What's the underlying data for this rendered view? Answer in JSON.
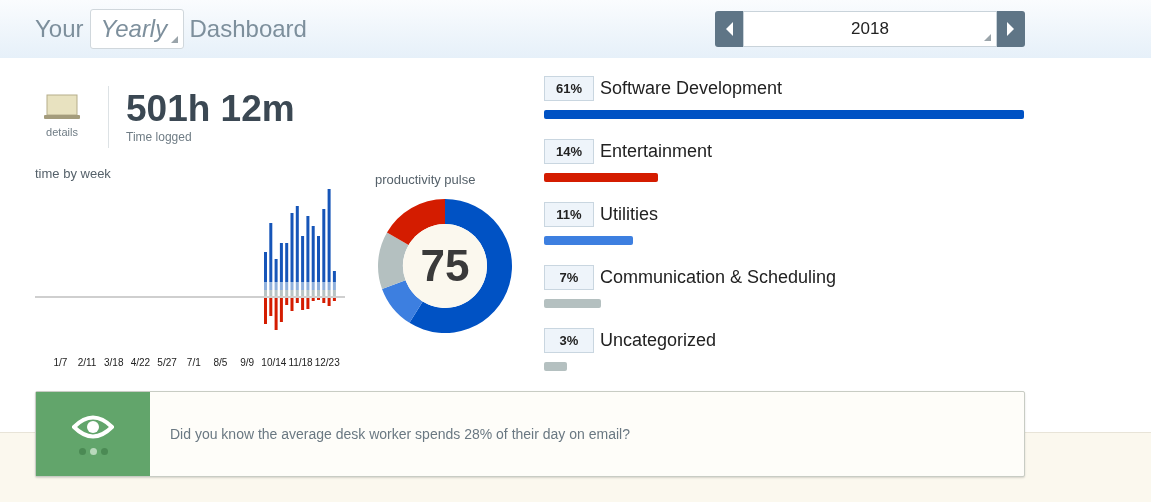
{
  "header": {
    "prefix": "Your",
    "period": "Yearly",
    "suffix": "Dashboard",
    "year": "2018"
  },
  "summary": {
    "details_label": "details",
    "total": "501h 12m",
    "total_label": "Time logged"
  },
  "time_by_week": {
    "title": "time by week",
    "week_labels": [
      "1/7",
      "2/11",
      "3/18",
      "4/22",
      "5/27",
      "7/1",
      "8/5",
      "9/9",
      "10/14",
      "11/18",
      "12/23"
    ]
  },
  "productivity_pulse": {
    "title": "productivity pulse",
    "score": "75"
  },
  "categories": [
    {
      "percent": "61%",
      "name": "Software Development",
      "color": "#0052c4"
    },
    {
      "percent": "14%",
      "name": "Entertainment",
      "color": "#d41c00"
    },
    {
      "percent": "11%",
      "name": "Utilities",
      "color": "#3d7fe0"
    },
    {
      "percent": "7%",
      "name": "Communication & Scheduling",
      "color": "#b4c0c0"
    },
    {
      "percent": "3%",
      "name": "Uncategorized",
      "color": "#b4c0c0"
    }
  ],
  "tip": {
    "text": "Did you know the average desk worker spends 28% of their day on email?",
    "pages": [
      {
        "selected": false
      },
      {
        "selected": true
      },
      {
        "selected": false
      }
    ]
  }
}
